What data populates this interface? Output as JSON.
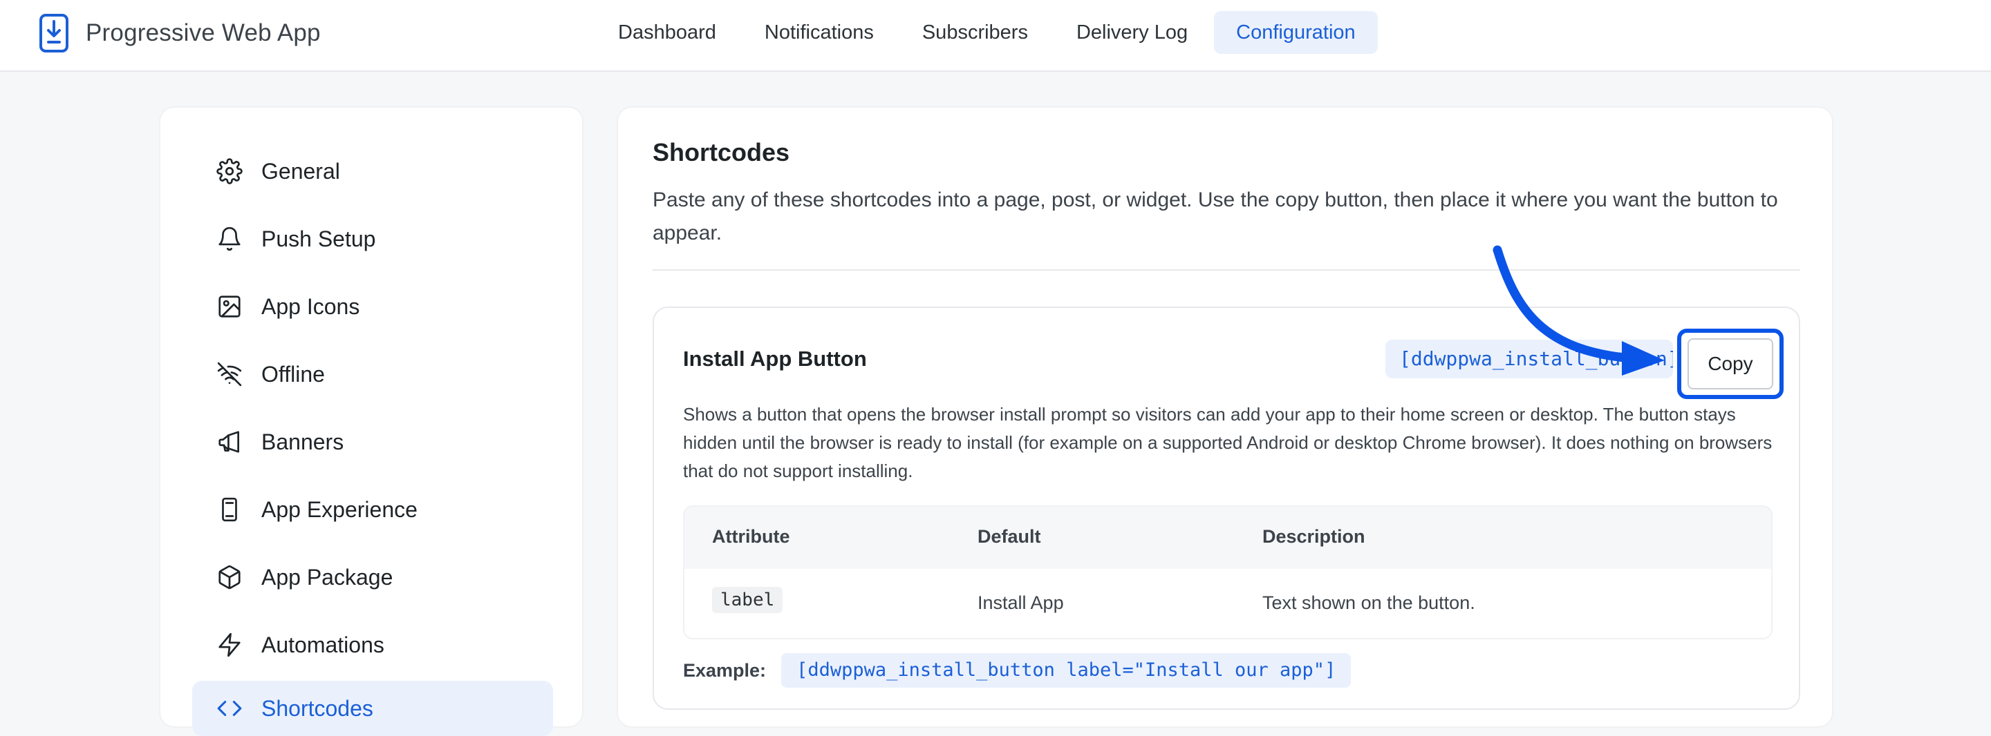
{
  "header": {
    "app_title": "Progressive Web App",
    "logo_icon": "phone-download-icon",
    "tabs": [
      {
        "label": "Dashboard",
        "active": false
      },
      {
        "label": "Notifications",
        "active": false
      },
      {
        "label": "Subscribers",
        "active": false
      },
      {
        "label": "Delivery Log",
        "active": false
      },
      {
        "label": "Configuration",
        "active": true
      }
    ]
  },
  "sidebar": {
    "items": [
      {
        "label": "General",
        "icon": "gear-icon",
        "active": false
      },
      {
        "label": "Push Setup",
        "icon": "bell-icon",
        "active": false
      },
      {
        "label": "App Icons",
        "icon": "image-icon",
        "active": false
      },
      {
        "label": "Offline",
        "icon": "wifi-off-icon",
        "active": false
      },
      {
        "label": "Banners",
        "icon": "megaphone-icon",
        "active": false
      },
      {
        "label": "App Experience",
        "icon": "mobile-icon",
        "active": false
      },
      {
        "label": "App Package",
        "icon": "package-icon",
        "active": false
      },
      {
        "label": "Automations",
        "icon": "bolt-icon",
        "active": false
      },
      {
        "label": "Shortcodes",
        "icon": "code-icon",
        "active": true
      }
    ]
  },
  "main": {
    "title": "Shortcodes",
    "description": "Paste any of these shortcodes into a page, post, or widget. Use the copy button, then place it where you want the button to appear.",
    "cards": [
      {
        "title": "Install App Button",
        "shortcode": "[ddwppwa_install_button]",
        "copy_label": "Copy",
        "description": "Shows a button that opens the browser install prompt so visitors can add your app to their home screen or desktop. The button stays hidden until the browser is ready to install (for example on a supported Android or desktop Chrome browser). It does nothing on browsers that do not support installing.",
        "table": {
          "headers": [
            "Attribute",
            "Default",
            "Description"
          ],
          "rows": [
            {
              "attribute": "label",
              "default": "Install App",
              "description": "Text shown on the button."
            }
          ]
        },
        "example_label": "Example:",
        "example_code": "[ddwppwa_install_button label=\"Install our app\"]"
      }
    ]
  },
  "colors": {
    "accent": "#1b5fd6",
    "accent_bg": "#eaf1fd",
    "annotation_arrow": "#0b54e8"
  }
}
